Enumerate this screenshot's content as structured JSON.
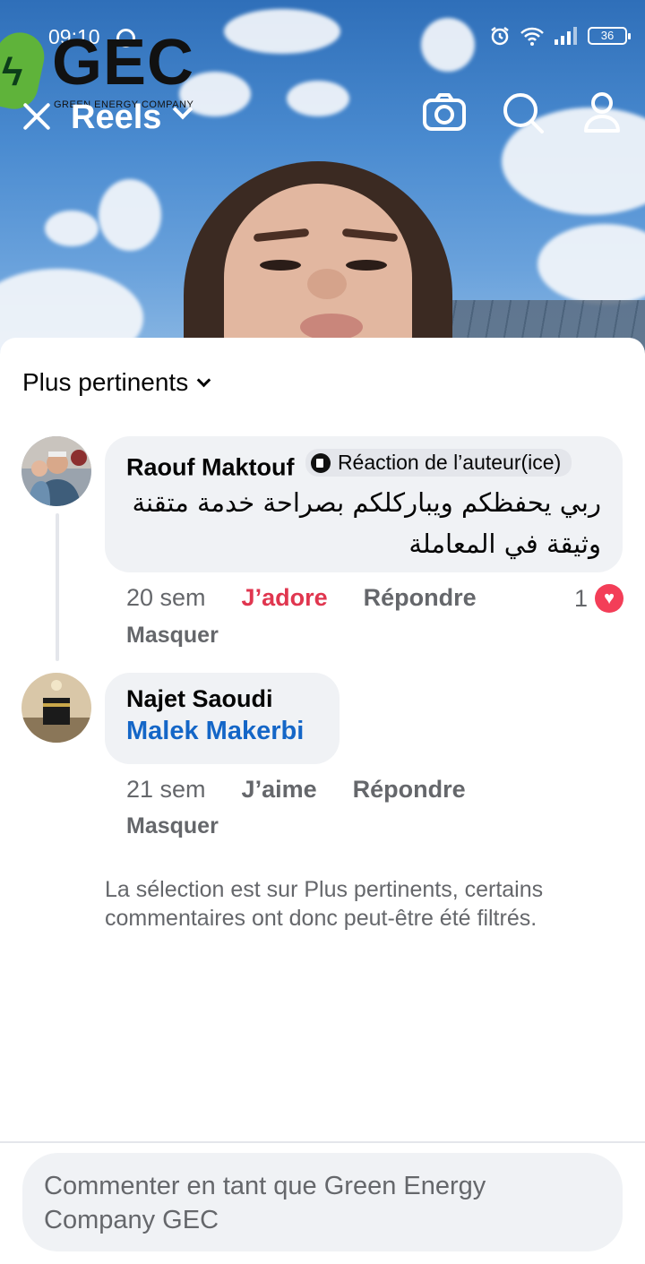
{
  "status_bar": {
    "time": "09:10",
    "battery": "36"
  },
  "logo": {
    "text": "GEC",
    "subtitle": "GREEN ENERGY COMPANY"
  },
  "header": {
    "title": "Reels",
    "icons": [
      "close-icon",
      "chevron-down-icon",
      "camera-icon",
      "search-icon",
      "profile-icon"
    ]
  },
  "comments": {
    "sort_label": "Plus pertinents",
    "items": [
      {
        "author": "Raouf Maktouf",
        "badge": "Réaction de l’auteur(ice)",
        "text_line1": "ربي يحفظكم ويباركلكم بصراحة خدمة متقنة",
        "text_line2": "وثيقة في المعاملة",
        "time": "20 sem",
        "reaction": "J’adore",
        "reply": "Répondre",
        "hide": "Masquer",
        "reaction_count": "1"
      },
      {
        "author": "Najet Saoudi",
        "mention": "Malek Makerbi",
        "time": "21 sem",
        "reaction": "J’aime",
        "reply": "Répondre",
        "hide": "Masquer"
      }
    ],
    "filter_note": "La sélection est sur Plus pertinents, certains commentaires ont donc peut-être été filtrés."
  },
  "composer": {
    "placeholder": "Commenter en tant que Green Energy Company GEC"
  },
  "colors": {
    "accent_blue": "#1466c7",
    "love_red": "#e0364f",
    "secondary_text": "#65676b",
    "bubble_bg": "#f0f2f5"
  }
}
